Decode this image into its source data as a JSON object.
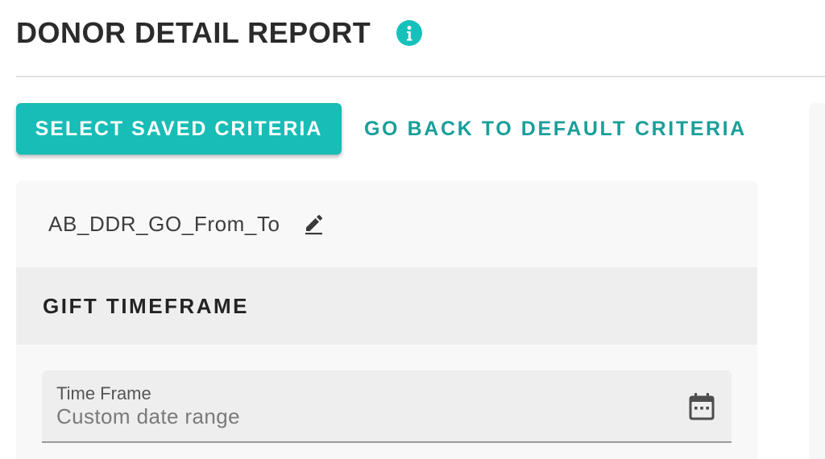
{
  "header": {
    "title": "DONOR DETAIL REPORT",
    "info_icon": "info-icon",
    "accent_color": "#17c1bb"
  },
  "actions": {
    "select_saved_label": "SELECT SAVED CRITERIA",
    "default_criteria_label": "GO BACK TO DEFAULT CRITERIA"
  },
  "criteria": {
    "name": "AB_DDR_GO_From_To",
    "edit_icon": "pencil-icon"
  },
  "gift_timeframe": {
    "section_title": "GIFT TIMEFRAME",
    "time_frame": {
      "label": "Time Frame",
      "value": "Custom date range",
      "icon": "calendar-icon"
    }
  },
  "colors": {
    "primary": "#17bdb6",
    "link": "#1a9f9a",
    "title_text": "#2b2b2b"
  }
}
